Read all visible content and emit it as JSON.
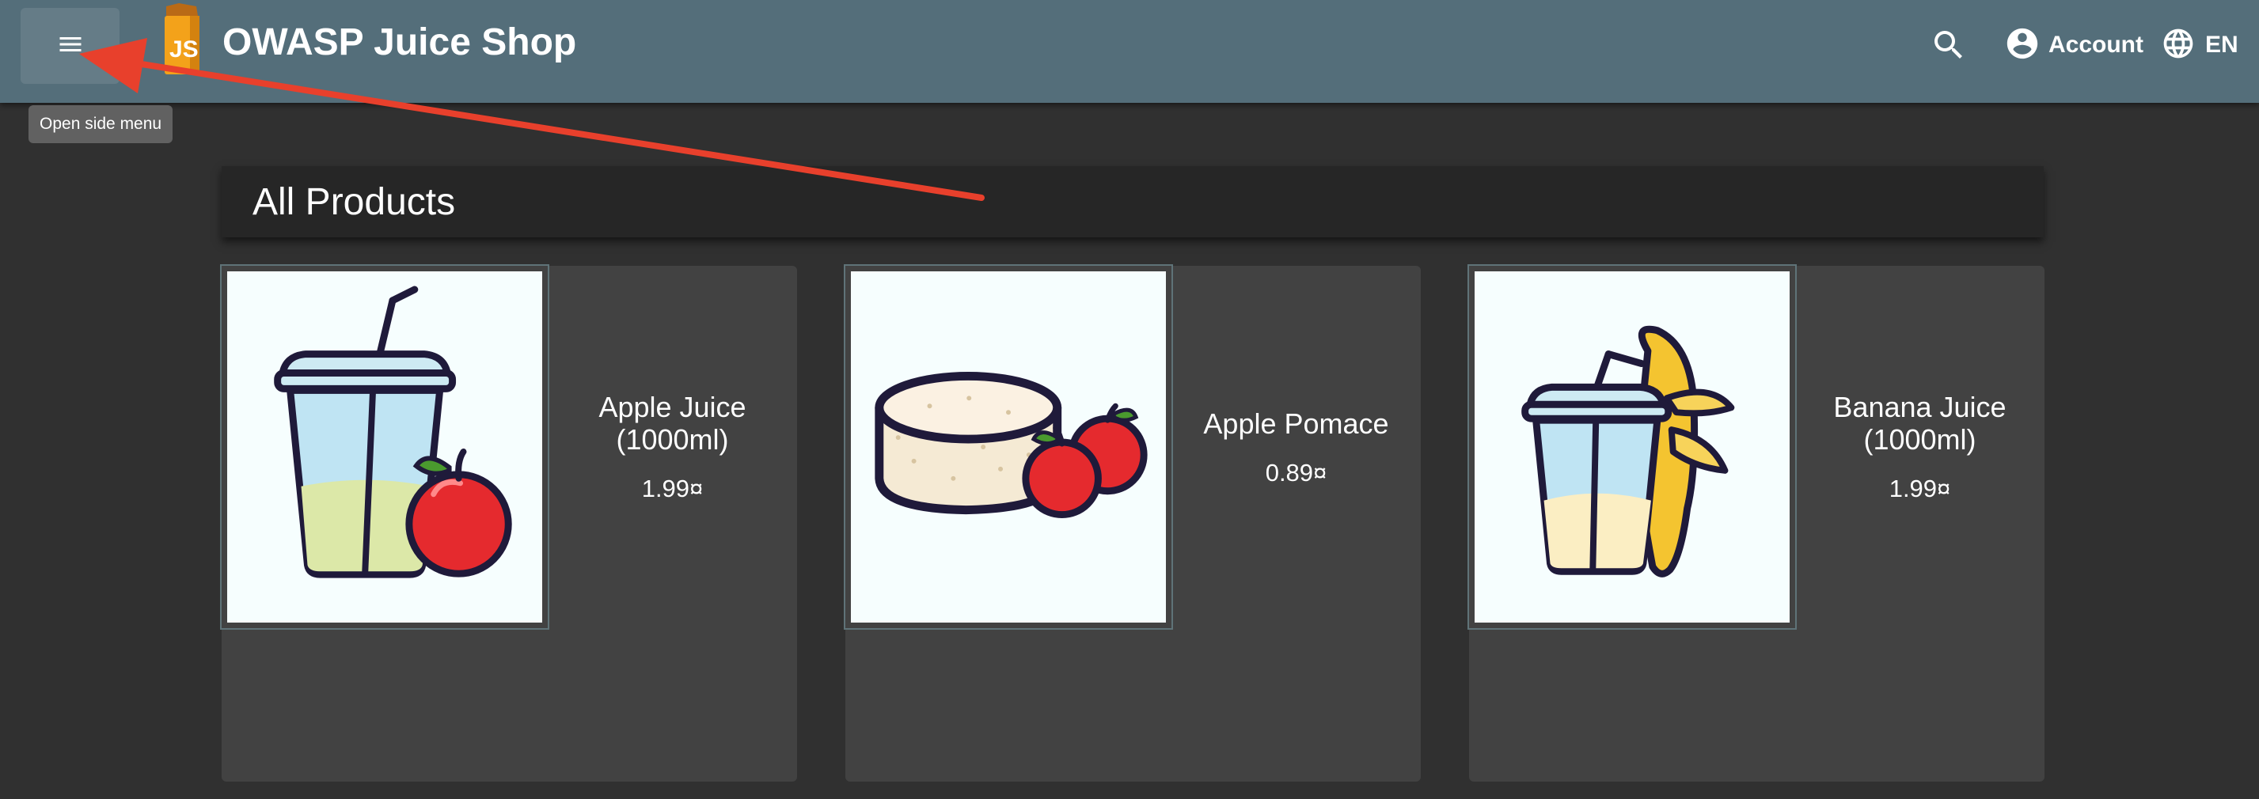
{
  "header": {
    "app_title": "OWASP Juice Shop",
    "account_label": "Account",
    "language_label": "EN",
    "toolbar_color": "#546e7a",
    "menu_icon": "menu-icon",
    "search_icon": "search-icon",
    "account_icon": "account-circle-icon",
    "language_icon": "globe-icon",
    "logo_text": "JS"
  },
  "tooltip": {
    "text": "Open side menu"
  },
  "main": {
    "heading": "All Products",
    "products": [
      {
        "name": "Apple Juice (1000ml)",
        "price": "1.99¤",
        "image": "apple-juice-cup-illustration"
      },
      {
        "name": "Apple Pomace",
        "price": "0.89¤",
        "image": "apple-pomace-illustration"
      },
      {
        "name": "Banana Juice (1000ml)",
        "price": "1.99¤",
        "image": "banana-juice-cup-illustration"
      }
    ]
  },
  "annotation": {
    "color": "#e8402c",
    "shape": "arrow"
  }
}
